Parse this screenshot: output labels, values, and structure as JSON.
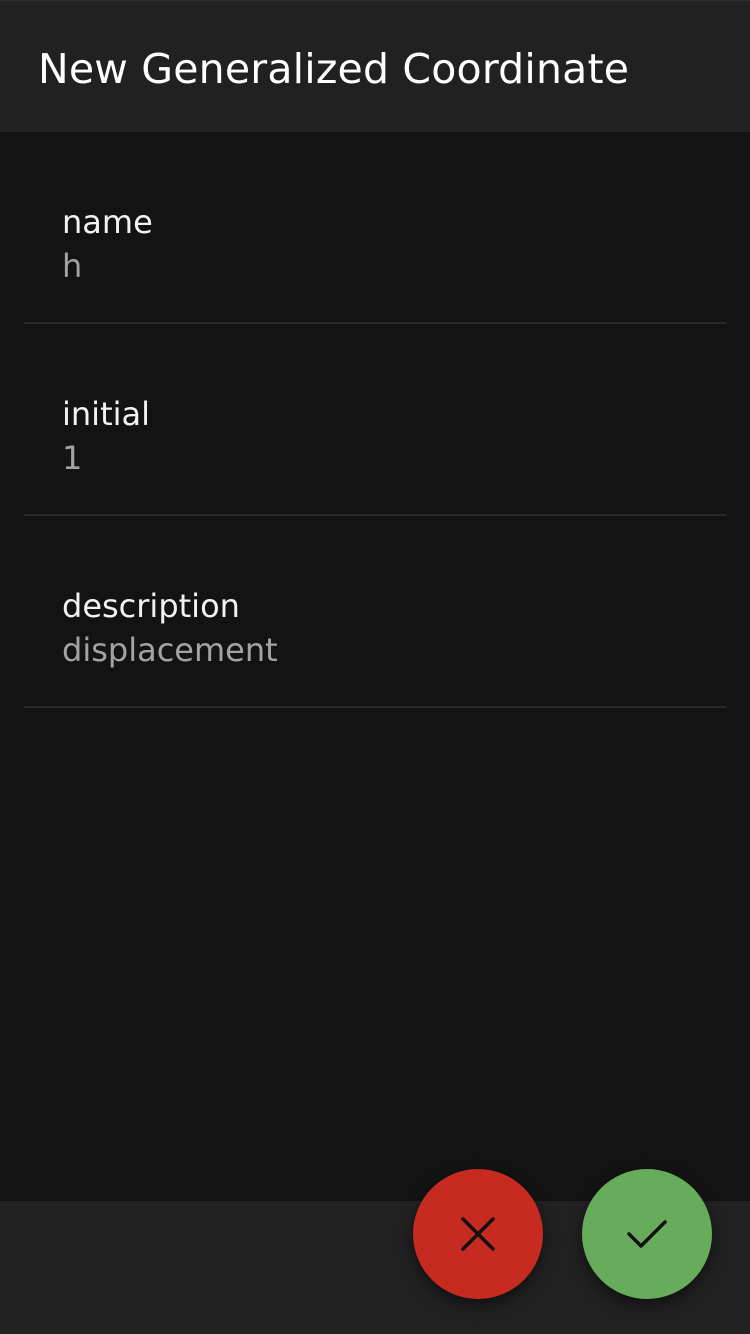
{
  "app_bar": {
    "title": "New Generalized Coordinate"
  },
  "form": {
    "fields": [
      {
        "label": "name",
        "value": "h"
      },
      {
        "label": "initial",
        "value": "1"
      },
      {
        "label": "description",
        "value": "displacement"
      }
    ]
  },
  "actions": {
    "cancel": {
      "icon": "close-icon",
      "color": "#c62a20"
    },
    "confirm": {
      "icon": "check-icon",
      "color": "#67ac5b"
    }
  },
  "colors": {
    "background": "#131313",
    "app_bar": "#212121",
    "label_text": "#f2f2f2",
    "value_text": "#a3a3a3"
  }
}
